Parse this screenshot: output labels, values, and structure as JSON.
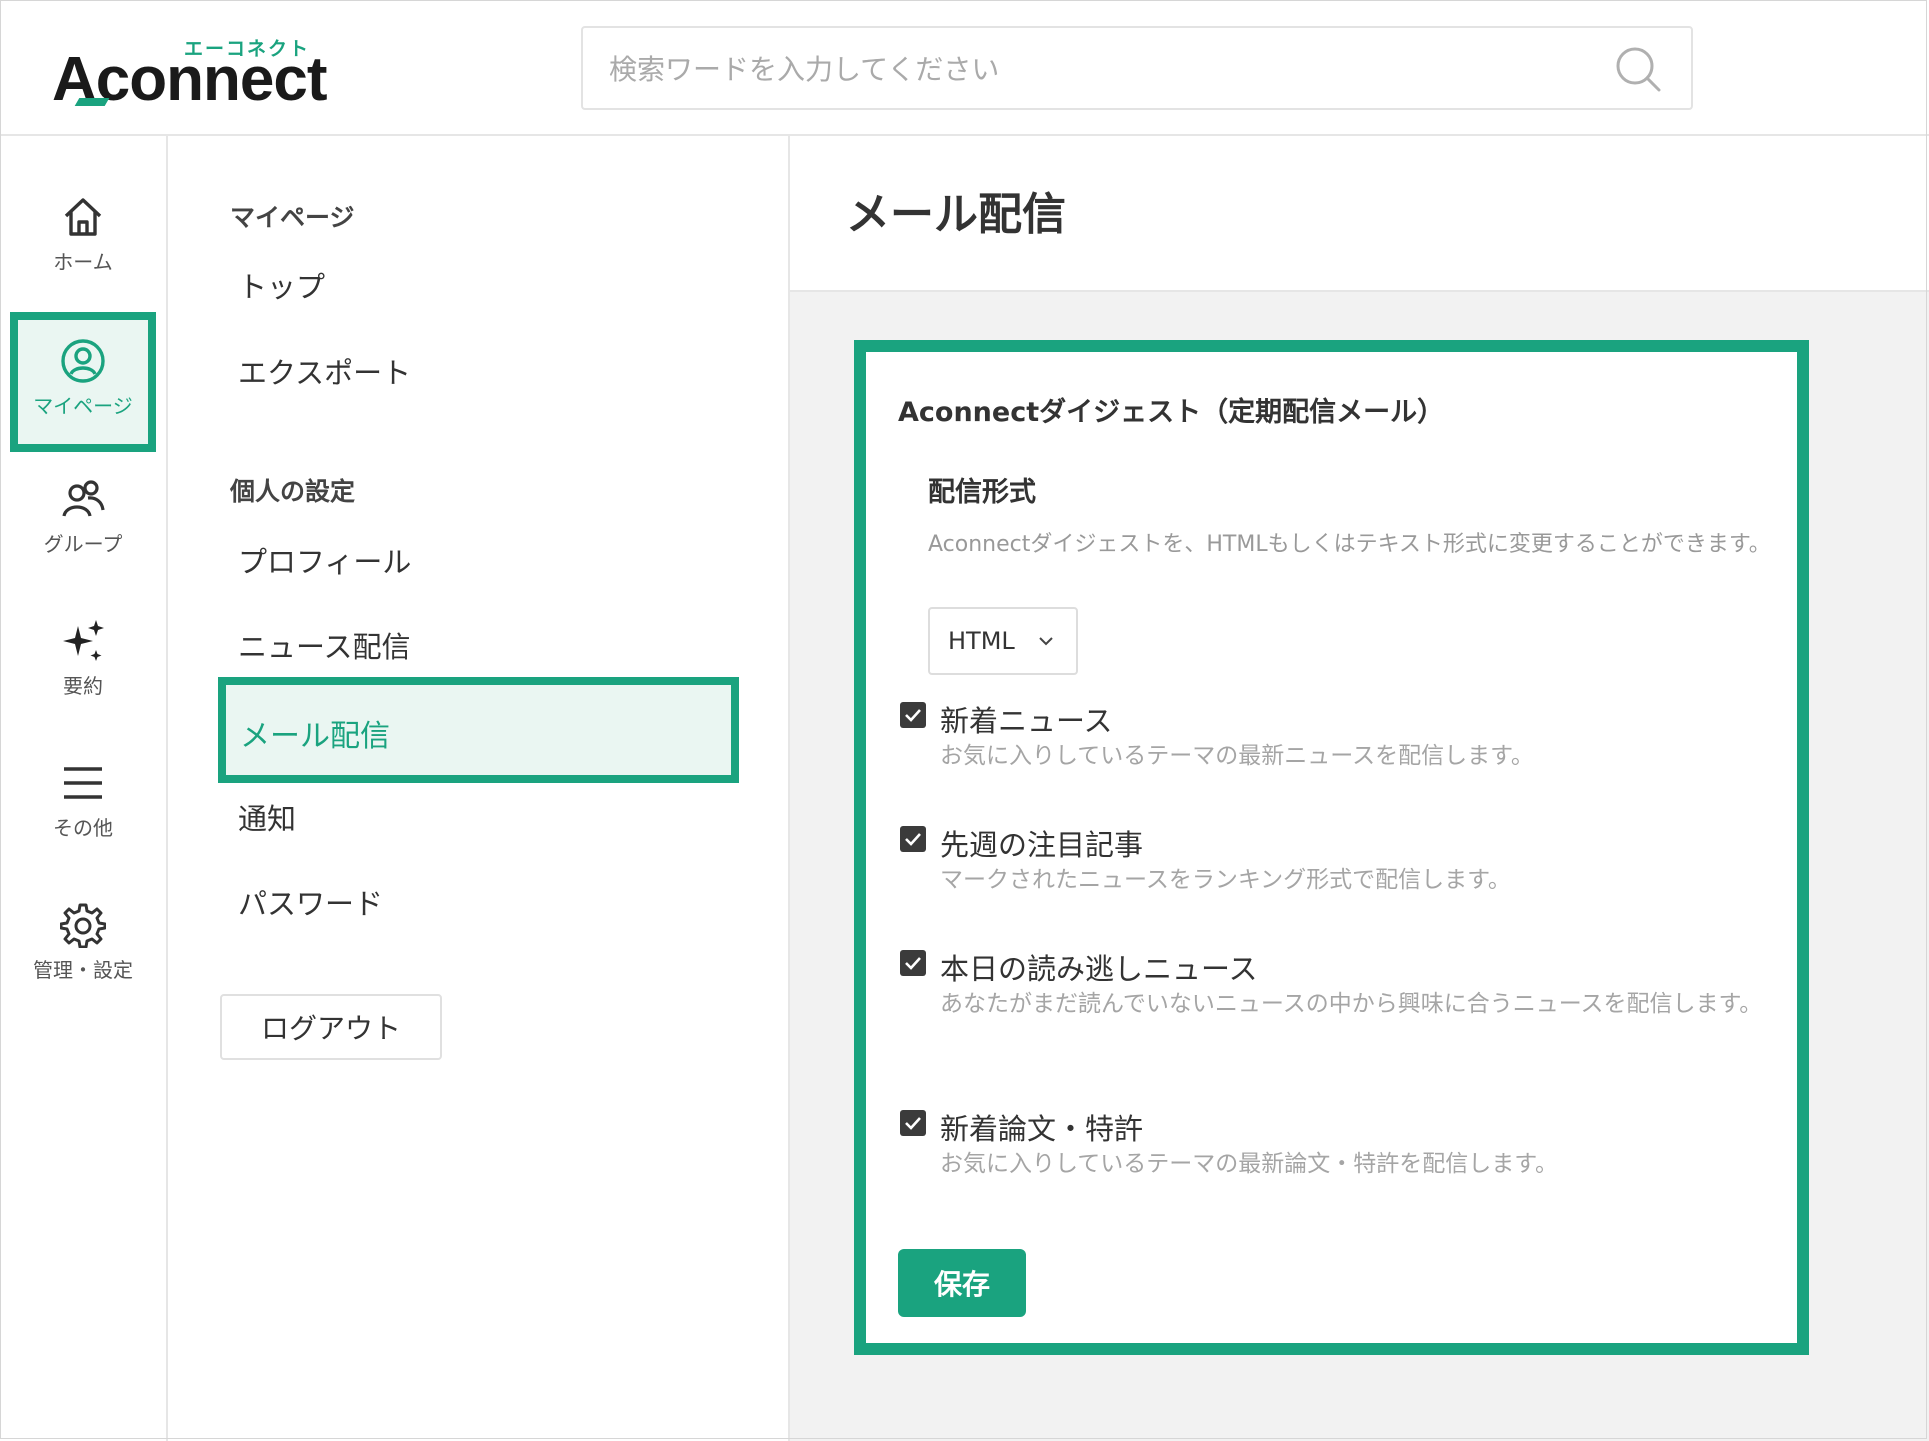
{
  "header": {
    "logo_kana": "エーコネクト",
    "logo_word": "Aconnect",
    "search_placeholder": "検索ワードを入力してください"
  },
  "rail": {
    "items": [
      {
        "label": "ホーム",
        "icon": "home-icon"
      },
      {
        "label": "マイページ",
        "icon": "user-circle-icon"
      },
      {
        "label": "グループ",
        "icon": "group-icon"
      },
      {
        "label": "要約",
        "icon": "sparkle-icon"
      },
      {
        "label": "その他",
        "icon": "menu-icon"
      },
      {
        "label": "管理・設定",
        "icon": "gear-icon"
      }
    ]
  },
  "submenu": {
    "heading_mypage": "マイページ",
    "top": "トップ",
    "export": "エクスポート",
    "heading_personal": "個人の設定",
    "profile": "プロフィール",
    "news": "ニュース配信",
    "mail": "メール配信",
    "notice": "通知",
    "password": "パスワード",
    "logout": "ログアウト"
  },
  "main": {
    "title": "メール配信",
    "card_title": "Aconnectダイジェスト（定期配信メール）",
    "format_title": "配信形式",
    "format_desc": "Aconnectダイジェストを、HTMLもしくはテキスト形式に変更することができます。",
    "format_value": "HTML",
    "options": [
      {
        "label": "新着ニュース",
        "desc": "お気に入りしているテーマの最新ニュースを配信します。",
        "checked": true
      },
      {
        "label": "先週の注目記事",
        "desc": "マークされたニュースをランキング形式で配信します。",
        "checked": true
      },
      {
        "label": "本日の読み逃しニュース",
        "desc": "あなたがまだ読んでいないニュースの中から興味に合うニュースを配信します。",
        "checked": true
      },
      {
        "label": "新着論文・特許",
        "desc": "お気に入りしているテーマの最新論文・特許を配信します。",
        "checked": true
      }
    ],
    "save": "保存"
  },
  "colors": {
    "accent": "#1aa37f",
    "text": "#333333",
    "muted": "#a5a5a5"
  }
}
